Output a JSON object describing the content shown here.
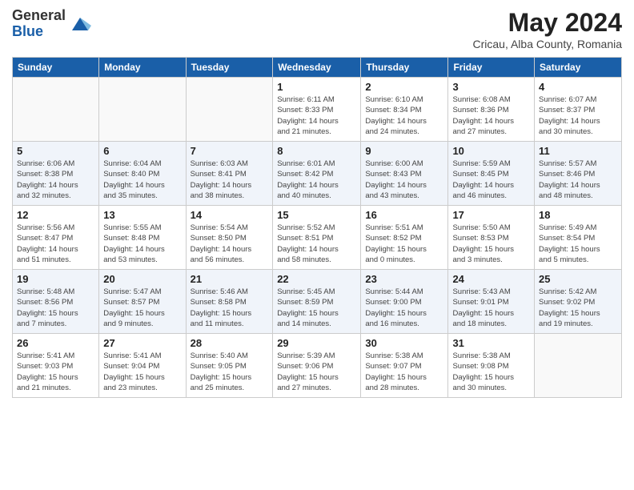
{
  "header": {
    "logo_general": "General",
    "logo_blue": "Blue",
    "month_year": "May 2024",
    "location": "Cricau, Alba County, Romania"
  },
  "weekdays": [
    "Sunday",
    "Monday",
    "Tuesday",
    "Wednesday",
    "Thursday",
    "Friday",
    "Saturday"
  ],
  "weeks": [
    [
      {
        "day": "",
        "info": ""
      },
      {
        "day": "",
        "info": ""
      },
      {
        "day": "",
        "info": ""
      },
      {
        "day": "1",
        "info": "Sunrise: 6:11 AM\nSunset: 8:33 PM\nDaylight: 14 hours\nand 21 minutes."
      },
      {
        "day": "2",
        "info": "Sunrise: 6:10 AM\nSunset: 8:34 PM\nDaylight: 14 hours\nand 24 minutes."
      },
      {
        "day": "3",
        "info": "Sunrise: 6:08 AM\nSunset: 8:36 PM\nDaylight: 14 hours\nand 27 minutes."
      },
      {
        "day": "4",
        "info": "Sunrise: 6:07 AM\nSunset: 8:37 PM\nDaylight: 14 hours\nand 30 minutes."
      }
    ],
    [
      {
        "day": "5",
        "info": "Sunrise: 6:06 AM\nSunset: 8:38 PM\nDaylight: 14 hours\nand 32 minutes."
      },
      {
        "day": "6",
        "info": "Sunrise: 6:04 AM\nSunset: 8:40 PM\nDaylight: 14 hours\nand 35 minutes."
      },
      {
        "day": "7",
        "info": "Sunrise: 6:03 AM\nSunset: 8:41 PM\nDaylight: 14 hours\nand 38 minutes."
      },
      {
        "day": "8",
        "info": "Sunrise: 6:01 AM\nSunset: 8:42 PM\nDaylight: 14 hours\nand 40 minutes."
      },
      {
        "day": "9",
        "info": "Sunrise: 6:00 AM\nSunset: 8:43 PM\nDaylight: 14 hours\nand 43 minutes."
      },
      {
        "day": "10",
        "info": "Sunrise: 5:59 AM\nSunset: 8:45 PM\nDaylight: 14 hours\nand 46 minutes."
      },
      {
        "day": "11",
        "info": "Sunrise: 5:57 AM\nSunset: 8:46 PM\nDaylight: 14 hours\nand 48 minutes."
      }
    ],
    [
      {
        "day": "12",
        "info": "Sunrise: 5:56 AM\nSunset: 8:47 PM\nDaylight: 14 hours\nand 51 minutes."
      },
      {
        "day": "13",
        "info": "Sunrise: 5:55 AM\nSunset: 8:48 PM\nDaylight: 14 hours\nand 53 minutes."
      },
      {
        "day": "14",
        "info": "Sunrise: 5:54 AM\nSunset: 8:50 PM\nDaylight: 14 hours\nand 56 minutes."
      },
      {
        "day": "15",
        "info": "Sunrise: 5:52 AM\nSunset: 8:51 PM\nDaylight: 14 hours\nand 58 minutes."
      },
      {
        "day": "16",
        "info": "Sunrise: 5:51 AM\nSunset: 8:52 PM\nDaylight: 15 hours\nand 0 minutes."
      },
      {
        "day": "17",
        "info": "Sunrise: 5:50 AM\nSunset: 8:53 PM\nDaylight: 15 hours\nand 3 minutes."
      },
      {
        "day": "18",
        "info": "Sunrise: 5:49 AM\nSunset: 8:54 PM\nDaylight: 15 hours\nand 5 minutes."
      }
    ],
    [
      {
        "day": "19",
        "info": "Sunrise: 5:48 AM\nSunset: 8:56 PM\nDaylight: 15 hours\nand 7 minutes."
      },
      {
        "day": "20",
        "info": "Sunrise: 5:47 AM\nSunset: 8:57 PM\nDaylight: 15 hours\nand 9 minutes."
      },
      {
        "day": "21",
        "info": "Sunrise: 5:46 AM\nSunset: 8:58 PM\nDaylight: 15 hours\nand 11 minutes."
      },
      {
        "day": "22",
        "info": "Sunrise: 5:45 AM\nSunset: 8:59 PM\nDaylight: 15 hours\nand 14 minutes."
      },
      {
        "day": "23",
        "info": "Sunrise: 5:44 AM\nSunset: 9:00 PM\nDaylight: 15 hours\nand 16 minutes."
      },
      {
        "day": "24",
        "info": "Sunrise: 5:43 AM\nSunset: 9:01 PM\nDaylight: 15 hours\nand 18 minutes."
      },
      {
        "day": "25",
        "info": "Sunrise: 5:42 AM\nSunset: 9:02 PM\nDaylight: 15 hours\nand 19 minutes."
      }
    ],
    [
      {
        "day": "26",
        "info": "Sunrise: 5:41 AM\nSunset: 9:03 PM\nDaylight: 15 hours\nand 21 minutes."
      },
      {
        "day": "27",
        "info": "Sunrise: 5:41 AM\nSunset: 9:04 PM\nDaylight: 15 hours\nand 23 minutes."
      },
      {
        "day": "28",
        "info": "Sunrise: 5:40 AM\nSunset: 9:05 PM\nDaylight: 15 hours\nand 25 minutes."
      },
      {
        "day": "29",
        "info": "Sunrise: 5:39 AM\nSunset: 9:06 PM\nDaylight: 15 hours\nand 27 minutes."
      },
      {
        "day": "30",
        "info": "Sunrise: 5:38 AM\nSunset: 9:07 PM\nDaylight: 15 hours\nand 28 minutes."
      },
      {
        "day": "31",
        "info": "Sunrise: 5:38 AM\nSunset: 9:08 PM\nDaylight: 15 hours\nand 30 minutes."
      },
      {
        "day": "",
        "info": ""
      }
    ]
  ]
}
